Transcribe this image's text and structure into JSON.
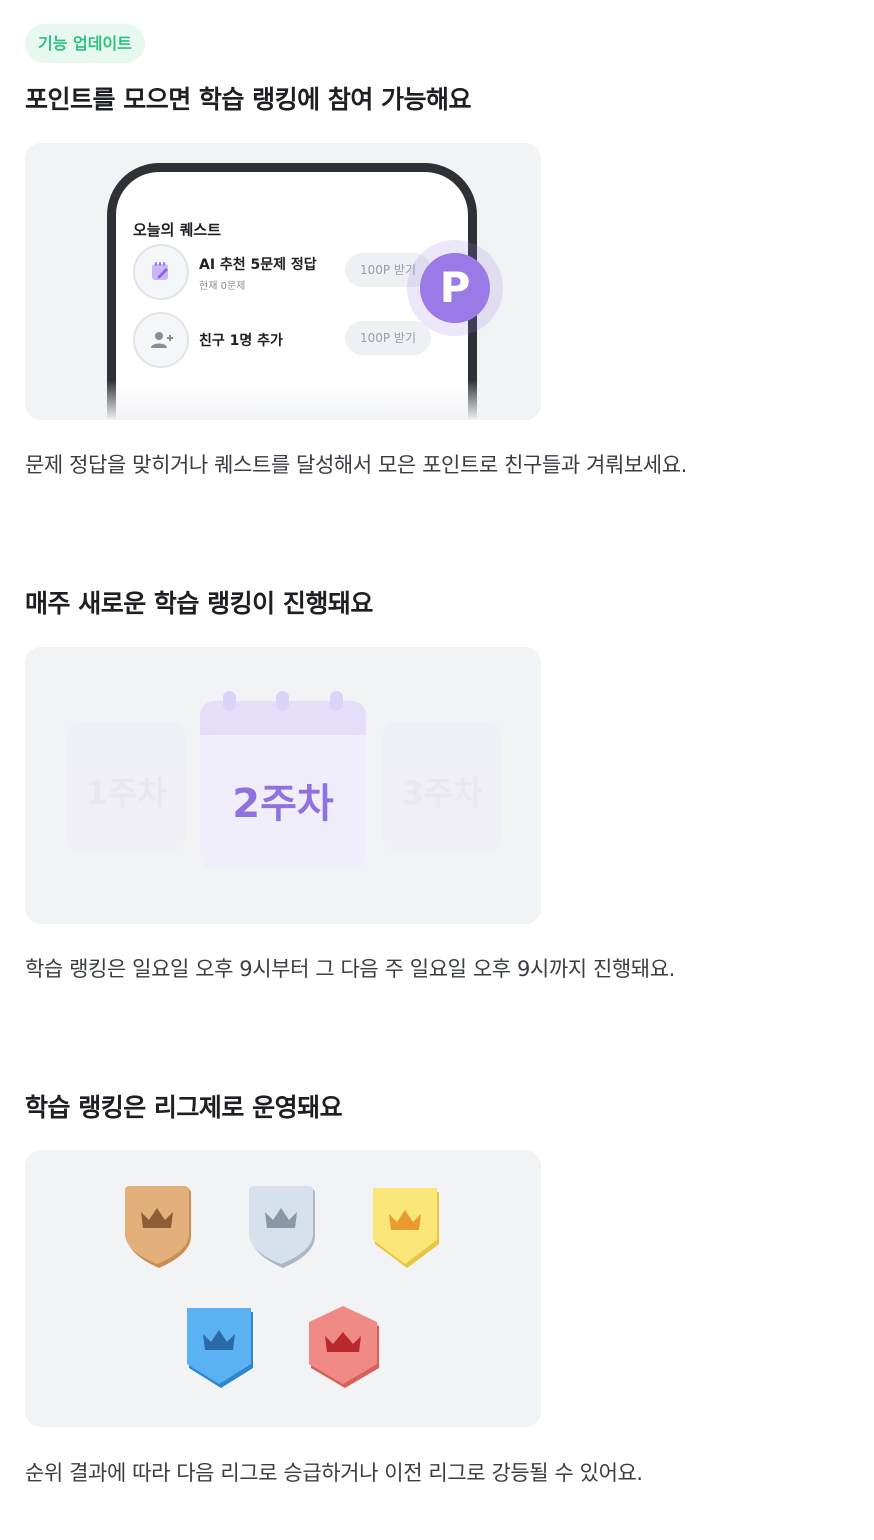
{
  "badge": {
    "label": "기능 업데이트"
  },
  "sections": [
    {
      "heading": "포인트를 모으면 학습 랭킹에 참여 가능해요",
      "description": "문제 정답을 맞히거나 퀘스트를 달성해서 모은 포인트로 친구들과 겨뤄보세요.",
      "illustration": {
        "title": "오늘의 퀘스트",
        "quests": [
          {
            "name": "AI 추천 5문제 정답",
            "sub": "현재 0문제",
            "button": "100P 받기",
            "icon": "calendar-edit-icon"
          },
          {
            "name": "친구 1명 추가",
            "sub": "",
            "button": "100P 받기",
            "icon": "add-friend-icon"
          }
        ],
        "coin_letter": "P"
      }
    },
    {
      "heading": "매주 새로운 학습 랭킹이 진행돼요",
      "description": "학습 랭킹은 일요일 오후 9시부터 그 다음 주 일요일 오후 9시까지 진행돼요.",
      "illustration": {
        "weeks": [
          "1주차",
          "2주차",
          "3주차"
        ]
      }
    },
    {
      "heading": "학습 랭킹은 리그제로 운영돼요",
      "description": "순위 결과에 따라 다음 리그로 승급하거나 이전 리그로 강등될 수 있어요.",
      "illustration": {
        "leagues": [
          {
            "name": "bronze",
            "color": "#e3b07c",
            "edge": "#c98e52",
            "crown": "#8d5d36"
          },
          {
            "name": "silver",
            "color": "#d6e1ed",
            "edge": "#a9b7c6",
            "crown": "#8b97a6"
          },
          {
            "name": "gold",
            "color": "#fbe67a",
            "edge": "#e8c53c",
            "crown": "#eb9a2e"
          },
          {
            "name": "sapphire",
            "color": "#5ab2f2",
            "edge": "#2f86cf",
            "crown": "#2a6aa6"
          },
          {
            "name": "ruby",
            "color": "#f08a86",
            "edge": "#d8605c",
            "crown": "#b8282c"
          }
        ]
      }
    }
  ],
  "colors": {
    "accent_purple": "#9a7ae6",
    "badge_green": "#2fbf7f",
    "card_bg": "#f2f3f5"
  }
}
